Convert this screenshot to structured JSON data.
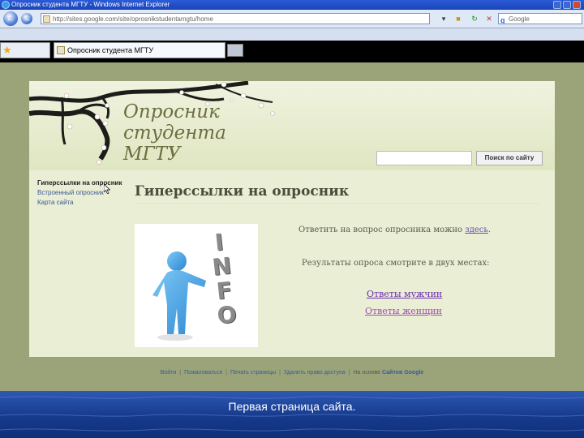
{
  "browser": {
    "window_title": "Опросник студента МГТУ - Windows Internet Explorer",
    "address": "http://sites.google.com/site/oprosnikstudentamgtu/home",
    "search_box": "Google",
    "tab_title": "Опросник студента МГТУ"
  },
  "site": {
    "title_line1": "Опросник",
    "title_line2": "студента",
    "title_line3": "МГТУ",
    "search_button": "Поиск по сайту",
    "sidebar": {
      "current": "Гиперссылки на опросник",
      "items": [
        "Встроенный опросник",
        "Карта сайта"
      ]
    },
    "heading": "Гиперссылки на опросник",
    "answer_text": "Ответить на вопрос опросника можно",
    "answer_link": "здесь",
    "answer_period": ".",
    "results_text": "Результаты опроса смотрите в двух местах:",
    "men_link": "Ответы мужчин",
    "women_link": "Ответы женщин",
    "image_label": "INFO"
  },
  "footer": {
    "items": [
      "Войти",
      "Пожаловаться",
      "Печать страницы",
      "Удалить право доступа"
    ],
    "powered_by": "На основе",
    "service": "Сайтов Google"
  },
  "caption": "Первая страница сайта.",
  "colors": {
    "site_bg": "#eaeed4",
    "viewport_bg": "#9aa478",
    "link": "#3b5a9a",
    "slide_blue": "#1b3f8f"
  }
}
